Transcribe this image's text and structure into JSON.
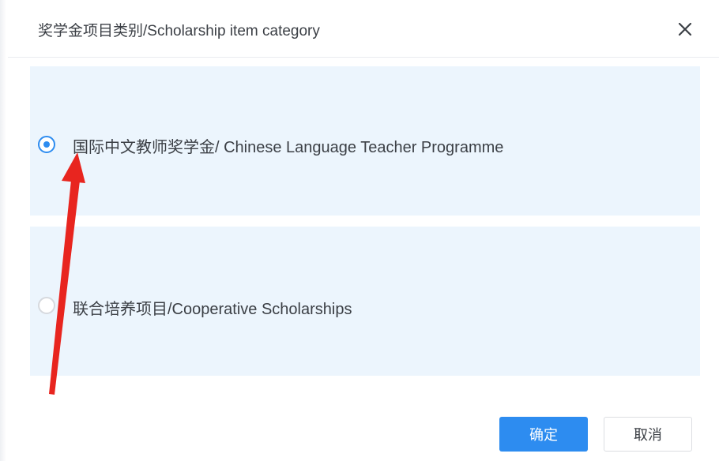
{
  "dialog": {
    "title": "奖学金项目类别/Scholarship item category",
    "close_icon": "close-icon"
  },
  "options": [
    {
      "label": "国际中文教师奖学金/ Chinese Language Teacher Programme",
      "selected": true
    },
    {
      "label": "联合培养项目/Cooperative Scholarships",
      "selected": false
    }
  ],
  "footer": {
    "confirm_label": "确定",
    "cancel_label": "取消"
  },
  "colors": {
    "accent": "#2d8cf0",
    "option_background": "#ecf5fd",
    "annotation_arrow": "#e8251f"
  }
}
